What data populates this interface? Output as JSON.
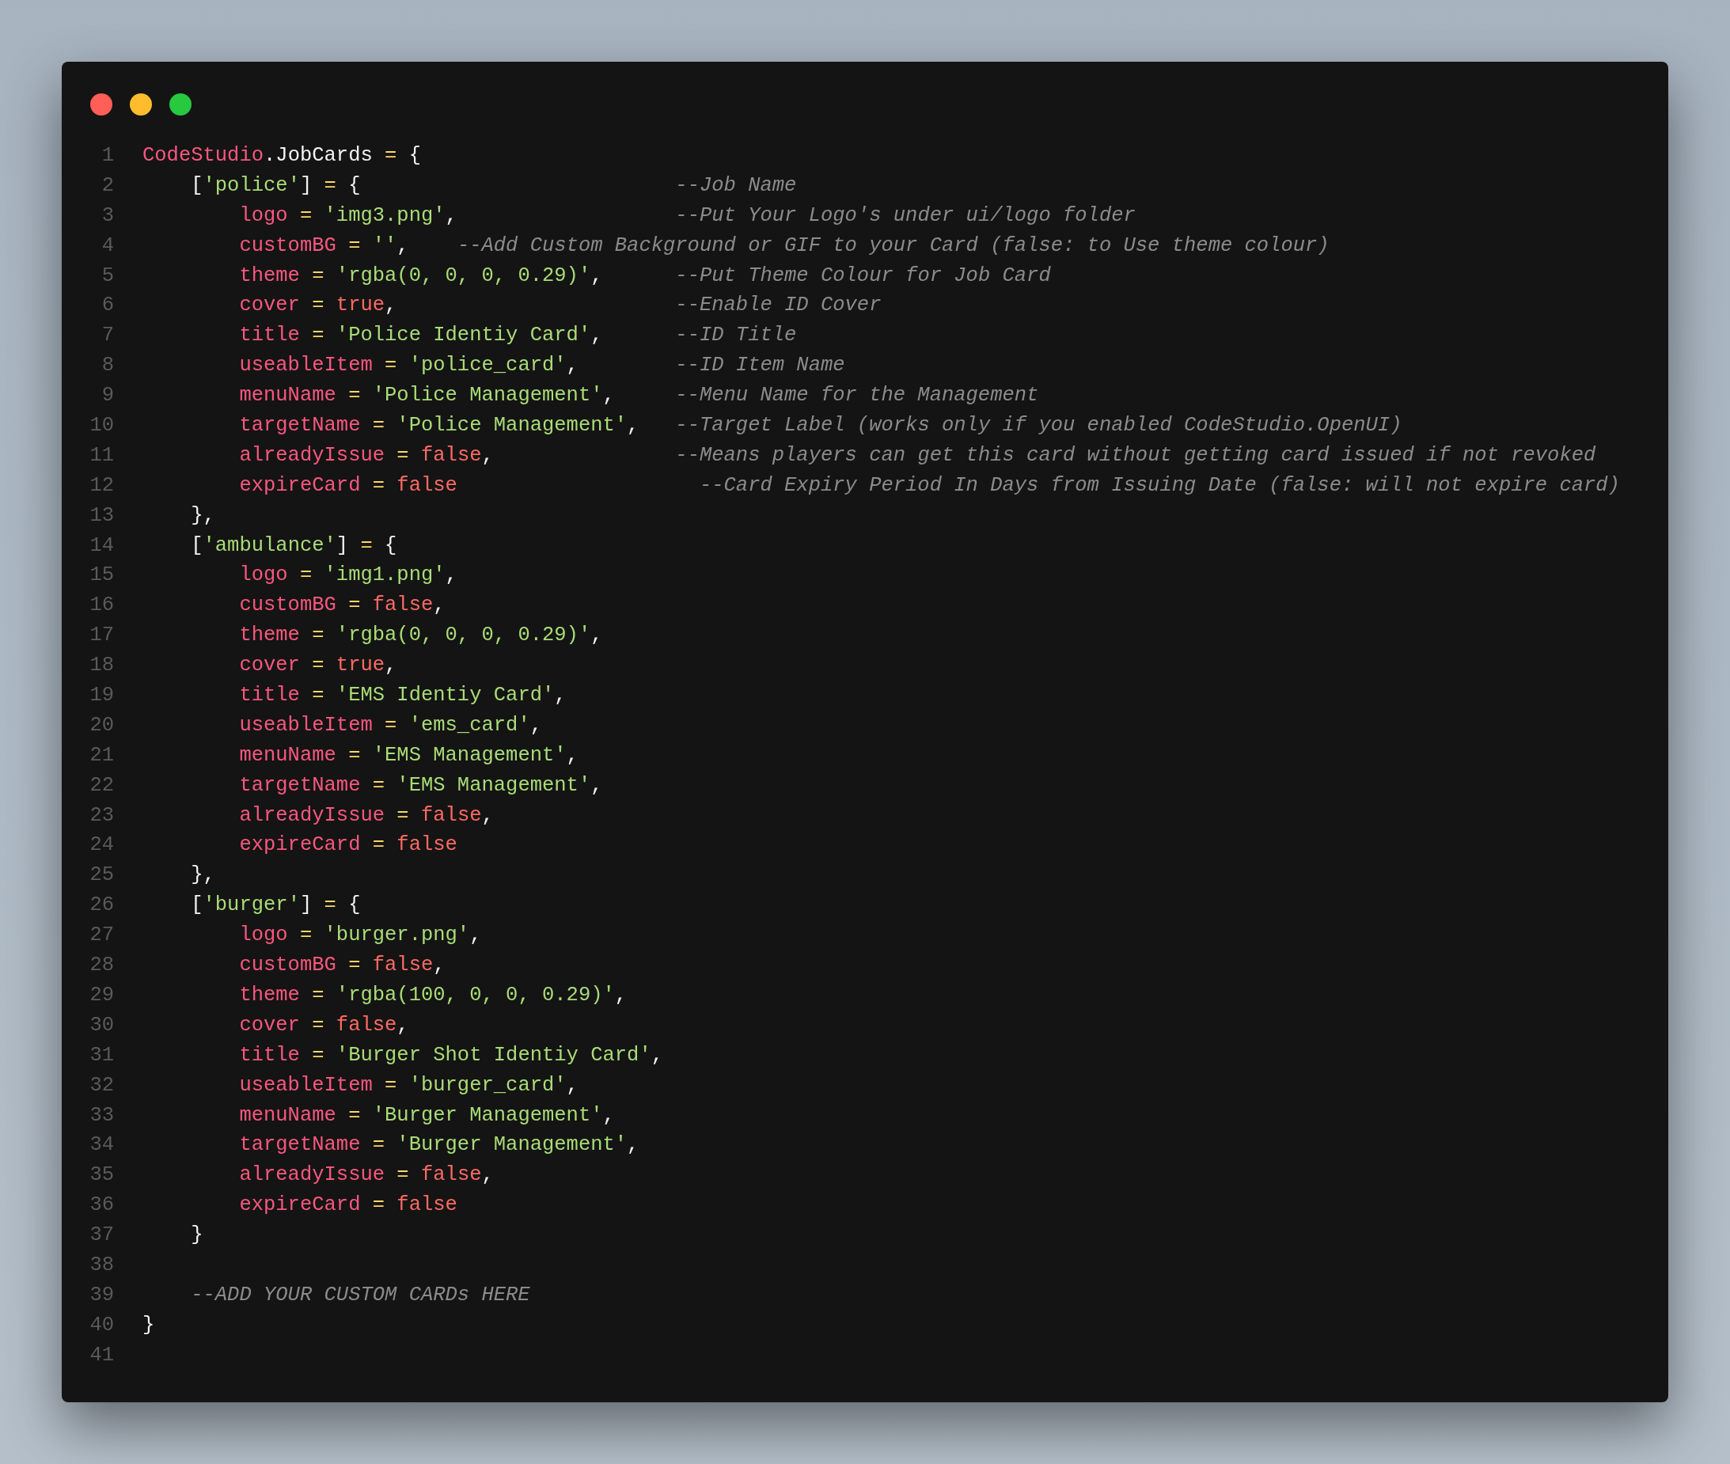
{
  "window": {
    "controls": [
      {
        "color": "#ff5f56"
      },
      {
        "color": "#ffbd2e"
      },
      {
        "color": "#27c93f"
      }
    ]
  },
  "code": [
    {
      "n": "1",
      "kind": "top",
      "tokens": [
        {
          "kind": "key",
          "text": "CodeStudio"
        },
        {
          "kind": "punct",
          "text": ".JobCards "
        },
        {
          "kind": "op",
          "text": "="
        },
        {
          "kind": "punct",
          "text": " {"
        }
      ]
    },
    {
      "n": "2",
      "kind": "entry",
      "tokens": [
        {
          "kind": "punct",
          "text": "["
        },
        {
          "kind": "str",
          "text": "'police'"
        },
        {
          "kind": "punct",
          "text": "] "
        },
        {
          "kind": "op",
          "text": "="
        },
        {
          "kind": "punct",
          "text": " {"
        }
      ],
      "comment": {
        "kind": "column",
        "text": "--Job Name"
      }
    },
    {
      "n": "3",
      "kind": "field",
      "tokens": [
        {
          "kind": "key",
          "text": "logo"
        },
        {
          "kind": "op",
          "text": " = "
        },
        {
          "kind": "str",
          "text": "'img3.png'"
        },
        {
          "kind": "punct",
          "text": ","
        }
      ],
      "comment": {
        "kind": "column",
        "text": "--Put Your Logo's under ui/logo folder"
      }
    },
    {
      "n": "4",
      "kind": "field",
      "tokens": [
        {
          "kind": "key",
          "text": "customBG"
        },
        {
          "kind": "op",
          "text": " = "
        },
        {
          "kind": "str",
          "text": "''"
        },
        {
          "kind": "punct",
          "text": ","
        }
      ],
      "comment": {
        "kind": "inline",
        "text": "--Add Custom Background or GIF to your Card (false: to Use theme colour)"
      }
    },
    {
      "n": "5",
      "kind": "field",
      "tokens": [
        {
          "kind": "key",
          "text": "theme"
        },
        {
          "kind": "op",
          "text": " = "
        },
        {
          "kind": "str",
          "text": "'rgba(0, 0, 0, 0.29)'"
        },
        {
          "kind": "punct",
          "text": ","
        }
      ],
      "comment": {
        "kind": "column",
        "text": "--Put Theme Colour for Job Card"
      }
    },
    {
      "n": "6",
      "kind": "field",
      "tokens": [
        {
          "kind": "key",
          "text": "cover"
        },
        {
          "kind": "op",
          "text": " = "
        },
        {
          "kind": "bool",
          "text": "true"
        },
        {
          "kind": "punct",
          "text": ","
        }
      ],
      "comment": {
        "kind": "column",
        "text": "--Enable ID Cover"
      }
    },
    {
      "n": "7",
      "kind": "field",
      "tokens": [
        {
          "kind": "key",
          "text": "title"
        },
        {
          "kind": "op",
          "text": " = "
        },
        {
          "kind": "str",
          "text": "'Police Identiy Card'"
        },
        {
          "kind": "punct",
          "text": ","
        }
      ],
      "comment": {
        "kind": "column",
        "text": "--ID Title"
      }
    },
    {
      "n": "8",
      "kind": "field",
      "tokens": [
        {
          "kind": "key",
          "text": "useableItem"
        },
        {
          "kind": "op",
          "text": " = "
        },
        {
          "kind": "str",
          "text": "'police_card'"
        },
        {
          "kind": "punct",
          "text": ","
        }
      ],
      "comment": {
        "kind": "column",
        "text": "--ID Item Name"
      }
    },
    {
      "n": "9",
      "kind": "field",
      "tokens": [
        {
          "kind": "key",
          "text": "menuName"
        },
        {
          "kind": "op",
          "text": " = "
        },
        {
          "kind": "str",
          "text": "'Police Management'"
        },
        {
          "kind": "punct",
          "text": ","
        }
      ],
      "comment": {
        "kind": "column",
        "text": "--Menu Name for the Management"
      }
    },
    {
      "n": "10",
      "kind": "field",
      "tokens": [
        {
          "kind": "key",
          "text": "targetName"
        },
        {
          "kind": "op",
          "text": " = "
        },
        {
          "kind": "str",
          "text": "'Police Management'"
        },
        {
          "kind": "punct",
          "text": ","
        }
      ],
      "comment": {
        "kind": "column",
        "text": "--Target Label (works only if you enabled CodeStudio.OpenUI)"
      }
    },
    {
      "n": "11",
      "kind": "field",
      "tokens": [
        {
          "kind": "key",
          "text": "alreadyIssue"
        },
        {
          "kind": "op",
          "text": " = "
        },
        {
          "kind": "bool",
          "text": "false"
        },
        {
          "kind": "punct",
          "text": ","
        }
      ],
      "comment": {
        "kind": "column",
        "text": "--Means players can get this card without getting card issued if not revoked"
      }
    },
    {
      "n": "12",
      "kind": "field",
      "tokens": [
        {
          "kind": "key",
          "text": "expireCard"
        },
        {
          "kind": "op",
          "text": " = "
        },
        {
          "kind": "bool",
          "text": "false"
        }
      ],
      "comment": {
        "kind": "offset",
        "text": "--Card Expiry Period In Days from Issuing Date (false: will not expire card)"
      }
    },
    {
      "n": "13",
      "kind": "entry",
      "tokens": [
        {
          "kind": "punct",
          "text": "},"
        }
      ]
    },
    {
      "n": "14",
      "kind": "entry",
      "tokens": [
        {
          "kind": "punct",
          "text": "["
        },
        {
          "kind": "str",
          "text": "'ambulance'"
        },
        {
          "kind": "punct",
          "text": "] "
        },
        {
          "kind": "op",
          "text": "="
        },
        {
          "kind": "punct",
          "text": " {"
        }
      ]
    },
    {
      "n": "15",
      "kind": "field",
      "tokens": [
        {
          "kind": "key",
          "text": "logo"
        },
        {
          "kind": "op",
          "text": " = "
        },
        {
          "kind": "str",
          "text": "'img1.png'"
        },
        {
          "kind": "punct",
          "text": ","
        }
      ]
    },
    {
      "n": "16",
      "kind": "field",
      "tokens": [
        {
          "kind": "key",
          "text": "customBG"
        },
        {
          "kind": "op",
          "text": " = "
        },
        {
          "kind": "bool",
          "text": "false"
        },
        {
          "kind": "punct",
          "text": ","
        }
      ]
    },
    {
      "n": "17",
      "kind": "field",
      "tokens": [
        {
          "kind": "key",
          "text": "theme"
        },
        {
          "kind": "op",
          "text": " = "
        },
        {
          "kind": "str",
          "text": "'rgba(0, 0, 0, 0.29)'"
        },
        {
          "kind": "punct",
          "text": ","
        }
      ]
    },
    {
      "n": "18",
      "kind": "field",
      "tokens": [
        {
          "kind": "key",
          "text": "cover"
        },
        {
          "kind": "op",
          "text": " = "
        },
        {
          "kind": "bool",
          "text": "true"
        },
        {
          "kind": "punct",
          "text": ","
        }
      ]
    },
    {
      "n": "19",
      "kind": "field",
      "tokens": [
        {
          "kind": "key",
          "text": "title"
        },
        {
          "kind": "op",
          "text": " = "
        },
        {
          "kind": "str",
          "text": "'EMS Identiy Card'"
        },
        {
          "kind": "punct",
          "text": ","
        }
      ]
    },
    {
      "n": "20",
      "kind": "field",
      "tokens": [
        {
          "kind": "key",
          "text": "useableItem"
        },
        {
          "kind": "op",
          "text": " = "
        },
        {
          "kind": "str",
          "text": "'ems_card'"
        },
        {
          "kind": "punct",
          "text": ","
        }
      ]
    },
    {
      "n": "21",
      "kind": "field",
      "tokens": [
        {
          "kind": "key",
          "text": "menuName"
        },
        {
          "kind": "op",
          "text": " = "
        },
        {
          "kind": "str",
          "text": "'EMS Management'"
        },
        {
          "kind": "punct",
          "text": ","
        }
      ]
    },
    {
      "n": "22",
      "kind": "field",
      "tokens": [
        {
          "kind": "key",
          "text": "targetName"
        },
        {
          "kind": "op",
          "text": " = "
        },
        {
          "kind": "str",
          "text": "'EMS Management'"
        },
        {
          "kind": "punct",
          "text": ","
        }
      ]
    },
    {
      "n": "23",
      "kind": "field",
      "tokens": [
        {
          "kind": "key",
          "text": "alreadyIssue"
        },
        {
          "kind": "op",
          "text": " = "
        },
        {
          "kind": "bool",
          "text": "false"
        },
        {
          "kind": "punct",
          "text": ","
        }
      ]
    },
    {
      "n": "24",
      "kind": "field",
      "tokens": [
        {
          "kind": "key",
          "text": "expireCard"
        },
        {
          "kind": "op",
          "text": " = "
        },
        {
          "kind": "bool",
          "text": "false"
        }
      ]
    },
    {
      "n": "25",
      "kind": "entry",
      "tokens": [
        {
          "kind": "punct",
          "text": "},"
        }
      ]
    },
    {
      "n": "26",
      "kind": "entry",
      "tokens": [
        {
          "kind": "punct",
          "text": "["
        },
        {
          "kind": "str",
          "text": "'burger'"
        },
        {
          "kind": "punct",
          "text": "] "
        },
        {
          "kind": "op",
          "text": "="
        },
        {
          "kind": "punct",
          "text": " {"
        }
      ]
    },
    {
      "n": "27",
      "kind": "field",
      "tokens": [
        {
          "kind": "key",
          "text": "logo"
        },
        {
          "kind": "op",
          "text": " = "
        },
        {
          "kind": "str",
          "text": "'burger.png'"
        },
        {
          "kind": "punct",
          "text": ","
        }
      ]
    },
    {
      "n": "28",
      "kind": "field",
      "tokens": [
        {
          "kind": "key",
          "text": "customBG"
        },
        {
          "kind": "op",
          "text": " = "
        },
        {
          "kind": "bool",
          "text": "false"
        },
        {
          "kind": "punct",
          "text": ","
        }
      ]
    },
    {
      "n": "29",
      "kind": "field",
      "tokens": [
        {
          "kind": "key",
          "text": "theme"
        },
        {
          "kind": "op",
          "text": " = "
        },
        {
          "kind": "str",
          "text": "'rgba(100, 0, 0, 0.29)'"
        },
        {
          "kind": "punct",
          "text": ","
        }
      ]
    },
    {
      "n": "30",
      "kind": "field",
      "tokens": [
        {
          "kind": "key",
          "text": "cover"
        },
        {
          "kind": "op",
          "text": " = "
        },
        {
          "kind": "bool",
          "text": "false"
        },
        {
          "kind": "punct",
          "text": ","
        }
      ]
    },
    {
      "n": "31",
      "kind": "field",
      "tokens": [
        {
          "kind": "key",
          "text": "title"
        },
        {
          "kind": "op",
          "text": " = "
        },
        {
          "kind": "str",
          "text": "'Burger Shot Identiy Card'"
        },
        {
          "kind": "punct",
          "text": ","
        }
      ]
    },
    {
      "n": "32",
      "kind": "field",
      "tokens": [
        {
          "kind": "key",
          "text": "useableItem"
        },
        {
          "kind": "op",
          "text": " = "
        },
        {
          "kind": "str",
          "text": "'burger_card'"
        },
        {
          "kind": "punct",
          "text": ","
        }
      ]
    },
    {
      "n": "33",
      "kind": "field",
      "tokens": [
        {
          "kind": "key",
          "text": "menuName"
        },
        {
          "kind": "op",
          "text": " = "
        },
        {
          "kind": "str",
          "text": "'Burger Management'"
        },
        {
          "kind": "punct",
          "text": ","
        }
      ]
    },
    {
      "n": "34",
      "kind": "field",
      "tokens": [
        {
          "kind": "key",
          "text": "targetName"
        },
        {
          "kind": "op",
          "text": " = "
        },
        {
          "kind": "str",
          "text": "'Burger Management'"
        },
        {
          "kind": "punct",
          "text": ","
        }
      ]
    },
    {
      "n": "35",
      "kind": "field",
      "tokens": [
        {
          "kind": "key",
          "text": "alreadyIssue"
        },
        {
          "kind": "op",
          "text": " = "
        },
        {
          "kind": "bool",
          "text": "false"
        },
        {
          "kind": "punct",
          "text": ","
        }
      ]
    },
    {
      "n": "36",
      "kind": "field",
      "tokens": [
        {
          "kind": "key",
          "text": "expireCard"
        },
        {
          "kind": "op",
          "text": " = "
        },
        {
          "kind": "bool",
          "text": "false"
        }
      ]
    },
    {
      "n": "37",
      "kind": "entry",
      "tokens": [
        {
          "kind": "punct",
          "text": "}"
        }
      ]
    },
    {
      "n": "38",
      "kind": "blank"
    },
    {
      "n": "39",
      "kind": "entry",
      "comment": {
        "kind": "inline",
        "text": "--ADD YOUR CUSTOM CARDs HERE"
      }
    },
    {
      "n": "40",
      "kind": "top",
      "tokens": [
        {
          "kind": "punct",
          "text": "}"
        }
      ]
    },
    {
      "n": "41",
      "kind": "blank"
    }
  ]
}
